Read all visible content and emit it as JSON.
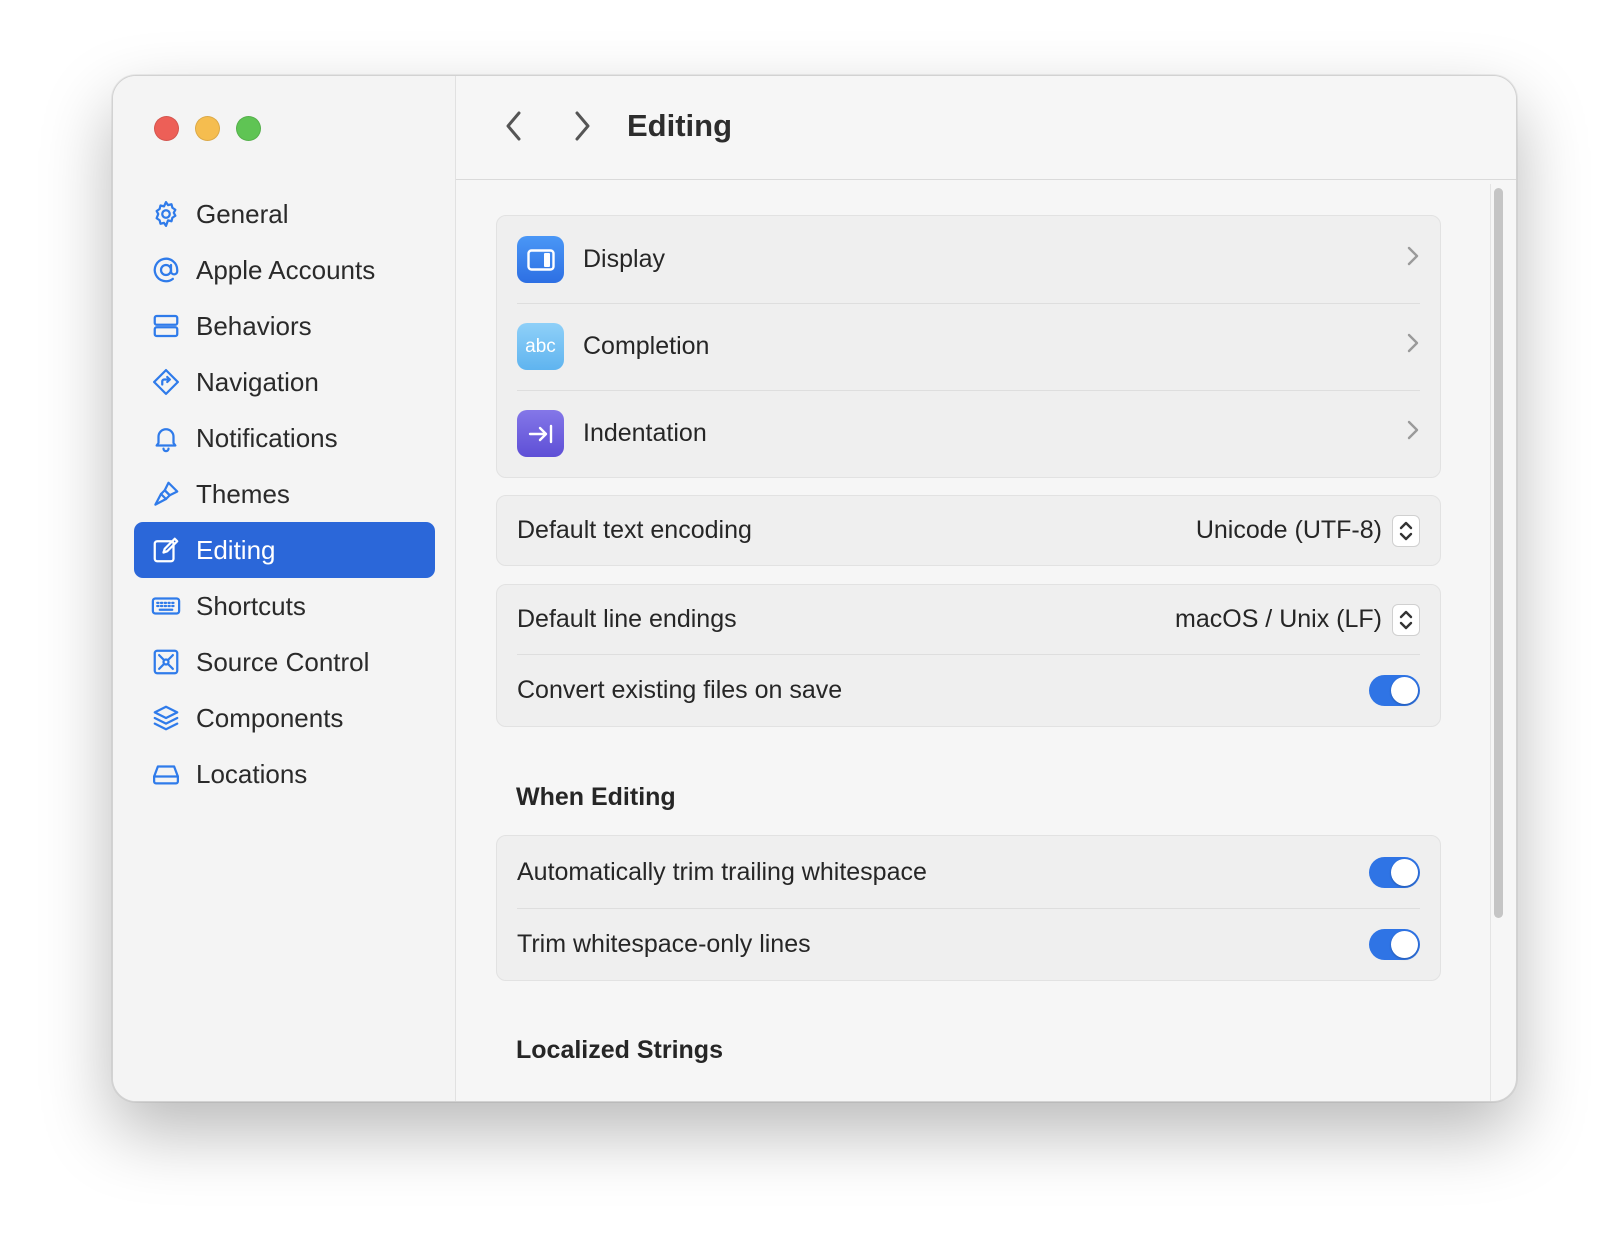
{
  "window": {
    "sidebar": {
      "items": [
        {
          "label": "General",
          "icon": "gear-icon"
        },
        {
          "label": "Apple Accounts",
          "icon": "at-icon"
        },
        {
          "label": "Behaviors",
          "icon": "behaviors-icon"
        },
        {
          "label": "Navigation",
          "icon": "navigation-icon"
        },
        {
          "label": "Notifications",
          "icon": "bell-icon"
        },
        {
          "label": "Themes",
          "icon": "paintbrush-icon"
        },
        {
          "label": "Editing",
          "icon": "edit-icon",
          "selected": true
        },
        {
          "label": "Shortcuts",
          "icon": "keyboard-icon"
        },
        {
          "label": "Source Control",
          "icon": "source-control-icon"
        },
        {
          "label": "Components",
          "icon": "layers-icon"
        },
        {
          "label": "Locations",
          "icon": "drive-icon"
        }
      ]
    },
    "toolbar": {
      "title": "Editing"
    },
    "main": {
      "nav_group": [
        {
          "label": "Display",
          "icon": "display-icon"
        },
        {
          "label": "Completion",
          "icon": "completion-icon",
          "icon_text": "abc"
        },
        {
          "label": "Indentation",
          "icon": "indentation-icon"
        }
      ],
      "encoding": {
        "label": "Default text encoding",
        "value": "Unicode (UTF-8)"
      },
      "line_endings": {
        "label": "Default line endings",
        "value": "macOS / Unix (LF)"
      },
      "convert": {
        "label": "Convert existing files on save",
        "enabled": true
      },
      "when_editing": {
        "title": "When Editing",
        "trim_trailing": {
          "label": "Automatically trim trailing whitespace",
          "enabled": true
        },
        "trim_lines": {
          "label": "Trim whitespace-only lines",
          "enabled": true
        }
      },
      "localized_strings": {
        "title": "Localized Strings"
      }
    },
    "colors": {
      "accent": "#2b67d9",
      "toggle_on": "#2f74e5",
      "icon_blue": "#2f7bea"
    }
  }
}
